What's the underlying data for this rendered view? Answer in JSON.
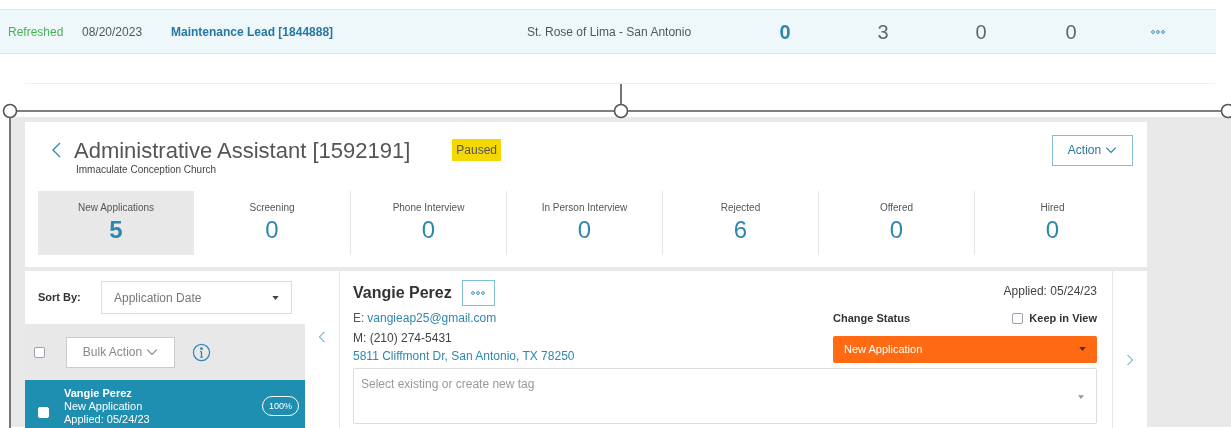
{
  "top_row": {
    "status": "Refreshed",
    "date": "08/20/2023",
    "title": "Maintenance Lead [1844888]",
    "location": "St. Rose of Lima - San Antonio",
    "counts": [
      {
        "value": "0",
        "emphasized": true
      },
      {
        "value": "3",
        "emphasized": false
      },
      {
        "value": "0",
        "emphasized": false
      },
      {
        "value": "0",
        "emphasized": false
      }
    ]
  },
  "job": {
    "title": "Administrative Assistant [1592191]",
    "organization": "Immaculate Conception Church",
    "status_badge": "Paused",
    "action_button": "Action"
  },
  "stages": [
    {
      "label": "New Applications",
      "count": "5",
      "selected": true
    },
    {
      "label": "Screening",
      "count": "0",
      "selected": false
    },
    {
      "label": "Phone Interview",
      "count": "0",
      "selected": false
    },
    {
      "label": "In Person Interview",
      "count": "0",
      "selected": false
    },
    {
      "label": "Rejected",
      "count": "6",
      "selected": false
    },
    {
      "label": "Offered",
      "count": "0",
      "selected": false
    },
    {
      "label": "Hired",
      "count": "0",
      "selected": false
    }
  ],
  "sort": {
    "label": "Sort By:",
    "value": "Application Date"
  },
  "bulk": {
    "checked": false,
    "label": "Bulk Action"
  },
  "applicants": [
    {
      "name": "Vangie Perez",
      "status": "New Application",
      "applied": "Applied: 05/24/23",
      "score": "100%",
      "checked": false,
      "selected": true
    }
  ],
  "detail": {
    "name": "Vangie Perez",
    "email_label": "E:",
    "email": "vangieap25@gmail.com",
    "phone": "M: (210) 274-5431",
    "address": "5811 Cliffmont Dr, San Antonio, TX 78250",
    "applied": "Applied: 05/24/23",
    "change_status_label": "Change Status",
    "status_value": "New Application",
    "keep_in_view": {
      "label": "Keep in View",
      "checked": false
    },
    "tag_placeholder": "Select existing or create new tag"
  }
}
